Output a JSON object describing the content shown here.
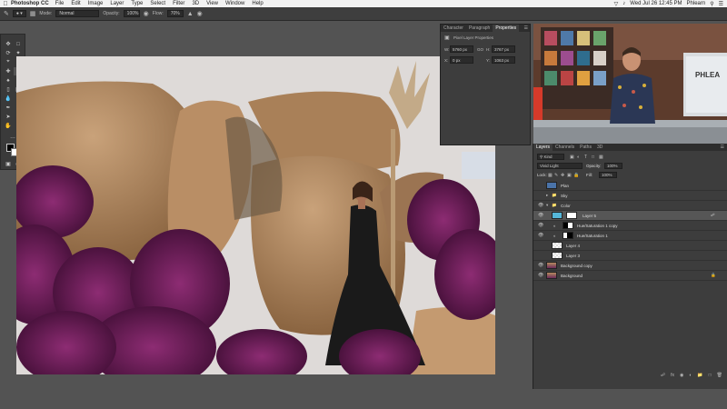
{
  "menubar": {
    "apple_icon": "apple-icon",
    "app_name": "Photoshop CC",
    "items": [
      "File",
      "Edit",
      "Image",
      "Layer",
      "Type",
      "Select",
      "Filter",
      "3D",
      "View",
      "Window",
      "Help"
    ],
    "datetime": "Wed Jul 26  12:45 PM",
    "user": "Phlearn"
  },
  "options": {
    "mode_label": "Mode:",
    "mode_value": "Normal",
    "opacity_label": "Opacity:",
    "opacity_value": "100%",
    "flow_label": "Flow:",
    "flow_value": "70%"
  },
  "properties": {
    "tabs": [
      "Character",
      "Paragraph",
      "Properties"
    ],
    "active_tab": "Properties",
    "title": "Pixel Layer Properties",
    "w_label": "W:",
    "w_value": "5760 px",
    "go_label": "GO",
    "h_label": "H:",
    "h_value": "3767 px",
    "x_label": "X:",
    "x_value": "0 px",
    "y_label": "Y:",
    "y_value": "1063 px"
  },
  "layers": {
    "tabs": [
      "Layers",
      "Channels",
      "Paths",
      "3D"
    ],
    "kind_label": "Kind",
    "blend_mode": "Vivid Light",
    "opacity_label": "Opacity:",
    "opacity_value": "100%",
    "lock_label": "Lock:",
    "fill_label": "Fill:",
    "fill_value": "100%",
    "rows": [
      {
        "name": "Plan",
        "kind": "layer"
      },
      {
        "name": "Sky",
        "kind": "group"
      },
      {
        "name": "Color",
        "kind": "group"
      },
      {
        "name": "Layer 5",
        "kind": "layer"
      },
      {
        "name": "Hue/Saturation 1 copy",
        "kind": "adjustment"
      },
      {
        "name": "Hue/Saturation 1",
        "kind": "adjustment"
      },
      {
        "name": "Layer 4",
        "kind": "layer"
      },
      {
        "name": "Layer 3",
        "kind": "layer"
      },
      {
        "name": "Background copy",
        "kind": "image"
      },
      {
        "name": "Background",
        "kind": "image"
      }
    ]
  },
  "webcam": {
    "sign_text": "PHLEA"
  },
  "colors": {
    "ui_bg": "#535353",
    "panel": "#3d3d3d",
    "selected_layer": "#565656",
    "selection_blue": "#4a7ab8"
  }
}
